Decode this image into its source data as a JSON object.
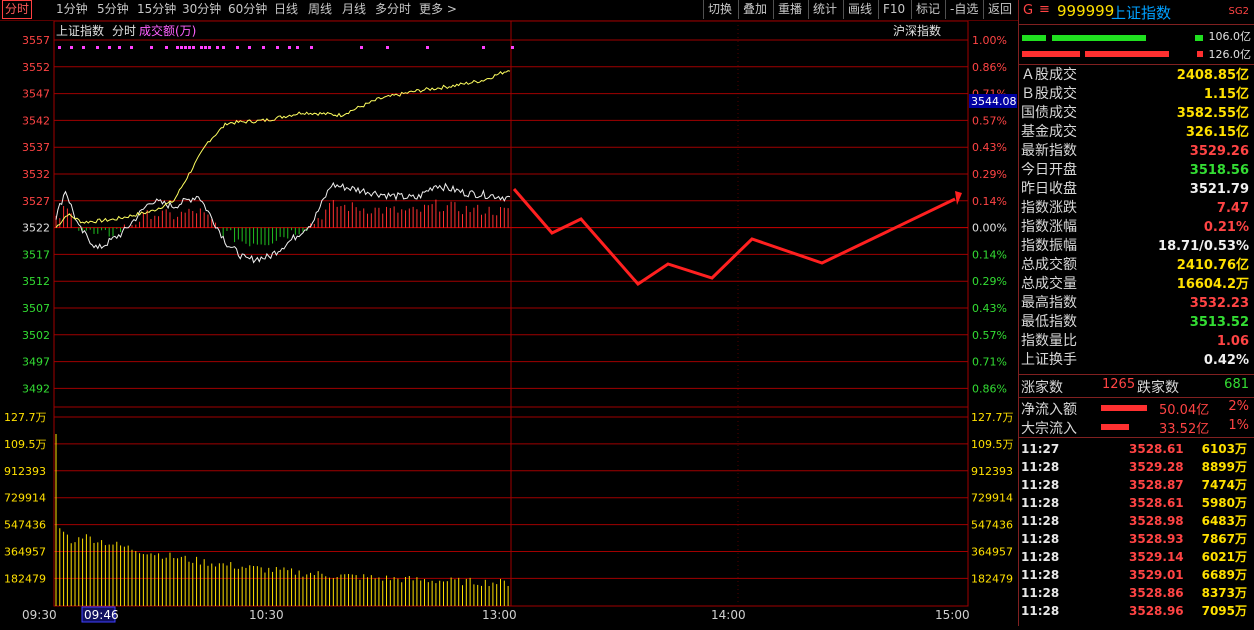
{
  "toolbar": {
    "tabs": [
      "分时",
      "1分钟",
      "5分钟",
      "15分钟",
      "30分钟",
      "60分钟",
      "日线",
      "周线",
      "月线",
      "多分时",
      "更多 >"
    ],
    "right_buttons": [
      "切换",
      "叠加",
      "重播",
      "统计",
      "画线",
      "F10",
      "标记",
      "-自选",
      "返回"
    ]
  },
  "chart": {
    "title": "上证指数",
    "subtitle": "分时",
    "volume_label": "成交额(万)",
    "overlay_label": "沪深指数",
    "current_price_tag": "3544.08",
    "price_ticks_left": [
      "3557",
      "3552",
      "3547",
      "3542",
      "3537",
      "3532",
      "3527",
      "3522",
      "3517",
      "3512",
      "3507",
      "3502",
      "3497",
      "3492"
    ],
    "pct_ticks_right": [
      "1.00%",
      "0.86%",
      "0.71%",
      "0.57%",
      "0.43%",
      "0.29%",
      "0.14%",
      "0.00%",
      "0.14%",
      "0.29%",
      "0.43%",
      "0.57%",
      "0.71%",
      "0.86%"
    ],
    "volume_ticks": [
      "127.7万",
      "109.5万",
      "912393",
      "729914",
      "547436",
      "364957",
      "182479"
    ],
    "time_labels": [
      "09:30",
      "09:46",
      "10:30",
      "13:00",
      "14:00",
      "15:00"
    ],
    "highlighted_time": "09:46",
    "colors": {
      "up": "#ff3030",
      "down": "#20c020",
      "index_line": "#ffff60",
      "avg_line": "#ffffff",
      "grid": "#a00000",
      "arrow": "#ff2020"
    }
  },
  "chart_data": {
    "type": "line",
    "title": "上证指数",
    "x": [
      "09:30",
      "09:46",
      "10:30",
      "11:30/13:00"
    ],
    "series": [
      {
        "name": "上证指数",
        "values": [
          3521.79,
          3524.0,
          3542.0,
          3551.5
        ]
      },
      {
        "name": "沪深指数",
        "values": [
          3524.5,
          3517.0,
          3528.5,
          3527.5
        ]
      }
    ],
    "ylim": [
      3492,
      3557
    ]
  },
  "header": {
    "code": "999999",
    "name": "上证指数",
    "flag": "G",
    "badge": "SG2"
  },
  "flow_bars": {
    "top_value": "106.0亿",
    "bottom_value": "126.0亿"
  },
  "stats": [
    {
      "label": "Ａ股成交",
      "value": "2408.85亿",
      "color": "yellow"
    },
    {
      "label": "Ｂ股成交",
      "value": "1.15亿",
      "color": "yellow"
    },
    {
      "label": "国债成交",
      "value": "3582.55亿",
      "color": "yellow"
    },
    {
      "label": "基金成交",
      "value": "326.15亿",
      "color": "yellow"
    },
    {
      "label": "最新指数",
      "value": "3529.26",
      "color": "red"
    },
    {
      "label": "今日开盘",
      "value": "3518.56",
      "color": "green"
    },
    {
      "label": "昨日收盘",
      "value": "3521.79",
      "color": "white"
    },
    {
      "label": "指数涨跌",
      "value": "7.47",
      "color": "red"
    },
    {
      "label": "指数涨幅",
      "value": "0.21%",
      "color": "red"
    },
    {
      "label": "指数振幅",
      "value": "18.71/0.53%",
      "color": "white"
    },
    {
      "label": "总成交额",
      "value": "2410.76亿",
      "color": "yellow"
    },
    {
      "label": "总成交量",
      "value": "16604.2万",
      "color": "yellow"
    },
    {
      "label": "最高指数",
      "value": "3532.23",
      "color": "red"
    },
    {
      "label": "最低指数",
      "value": "3513.52",
      "color": "green"
    },
    {
      "label": "指数量比",
      "value": "1.06",
      "color": "red"
    },
    {
      "label": "上证换手",
      "value": "0.42%",
      "color": "white"
    }
  ],
  "updown": {
    "up_label": "涨家数",
    "up_value": "1265",
    "down_label": "跌家数",
    "down_value": "681"
  },
  "flows": [
    {
      "label": "净流入额",
      "value": "50.04亿",
      "pct": "2%"
    },
    {
      "label": "大宗流入",
      "value": "33.52亿",
      "pct": "1%"
    }
  ],
  "ticks": [
    {
      "time": "11:27",
      "price": "3528.61",
      "vol": "6103万"
    },
    {
      "time": "11:28",
      "price": "3529.28",
      "vol": "8899万"
    },
    {
      "time": "11:28",
      "price": "3528.87",
      "vol": "7474万"
    },
    {
      "time": "11:28",
      "price": "3528.61",
      "vol": "5980万"
    },
    {
      "time": "11:28",
      "price": "3528.98",
      "vol": "6483万"
    },
    {
      "time": "11:28",
      "price": "3528.93",
      "vol": "7867万"
    },
    {
      "time": "11:28",
      "price": "3529.14",
      "vol": "6021万"
    },
    {
      "time": "11:28",
      "price": "3529.01",
      "vol": "6689万"
    },
    {
      "time": "11:28",
      "price": "3528.86",
      "vol": "8373万"
    },
    {
      "time": "11:28",
      "price": "3528.96",
      "vol": "7095万"
    }
  ]
}
